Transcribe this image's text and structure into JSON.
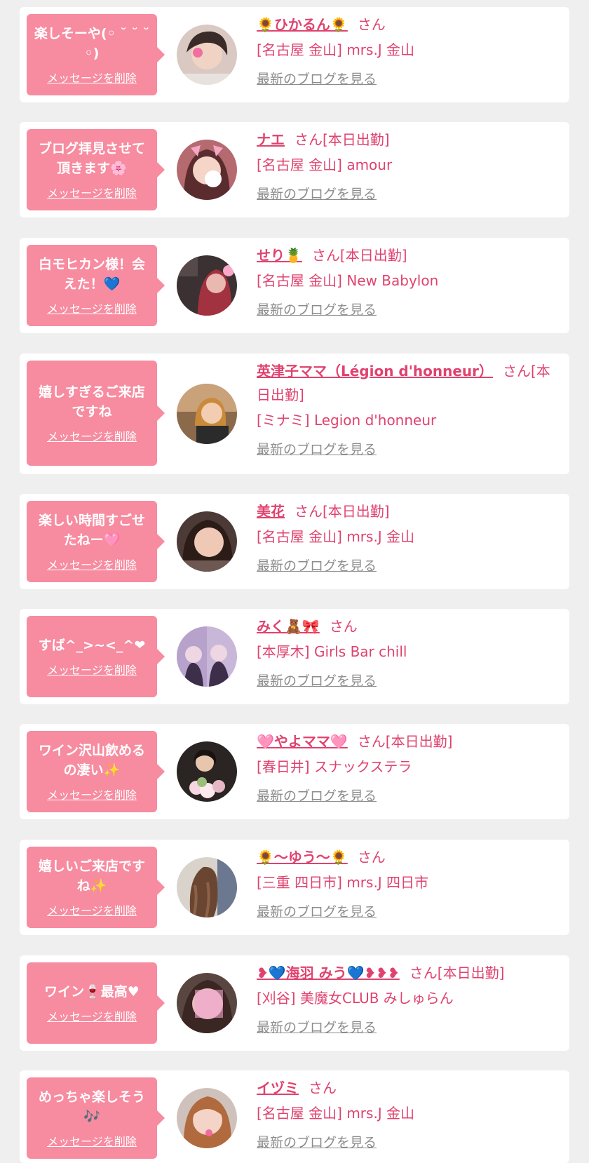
{
  "delete_label": "メッセージを削除",
  "blog_label": "最新のブログを見る",
  "colors": {
    "bubble": "#f78ba0",
    "accent": "#e0426e",
    "muted": "#8c8c8c",
    "background": "#efefef"
  },
  "messages": [
    {
      "bubble": "楽しそーや(◦ ˘ ˘ ˘◦)",
      "name": "🌻ひかるん🌻",
      "honorific": "さん",
      "shop": "[名古屋 金山] mrs.J 金山"
    },
    {
      "bubble": "ブログ拝見させて頂きます🌸",
      "name": "ナエ",
      "honorific": "さん[本日出勤]",
      "shop": "[名古屋 金山] amour"
    },
    {
      "bubble": "白モヒカン様！会えた！💙",
      "name": "せり🍍",
      "honorific": "さん[本日出勤]",
      "shop": "[名古屋 金山] New Babylon"
    },
    {
      "bubble": "嬉しすぎるご来店ですね",
      "name": "英津子ママ（Légion d'honneur）",
      "honorific": "さん[本日出勤]",
      "shop": "[ミナミ] Legion d'honneur"
    },
    {
      "bubble": "楽しい時間すごせたねー🩷",
      "name": "美花",
      "honorific": "さん[本日出勤]",
      "shop": "[名古屋 金山] mrs.J 金山"
    },
    {
      "bubble": "すば^_>~<_^❤",
      "name": "みく🧸🎀",
      "honorific": "さん",
      "shop": "[本厚木] Girls Bar chill"
    },
    {
      "bubble": "ワイン沢山飲めるの凄い✨",
      "name": "🩷やよママ🩷",
      "honorific": "さん[本日出勤]",
      "shop": "[春日井] スナックステラ"
    },
    {
      "bubble": "嬉しいご来店ですね✨",
      "name": "🌻〜ゆう〜🌻",
      "honorific": "さん",
      "shop": "[三重 四日市] mrs.J 四日市"
    },
    {
      "bubble": "ワイン🍷最高♥",
      "name": "❥💙海羽 みう💙❥❥❥",
      "honorific": "さん[本日出勤]",
      "shop": "[刈谷] 美魔女CLUB みしゅらん"
    },
    {
      "bubble": "めっちゃ楽しそう🎶",
      "name": "イヅミ",
      "honorific": "さん",
      "shop": "[名古屋 金山] mrs.J 金山"
    }
  ]
}
